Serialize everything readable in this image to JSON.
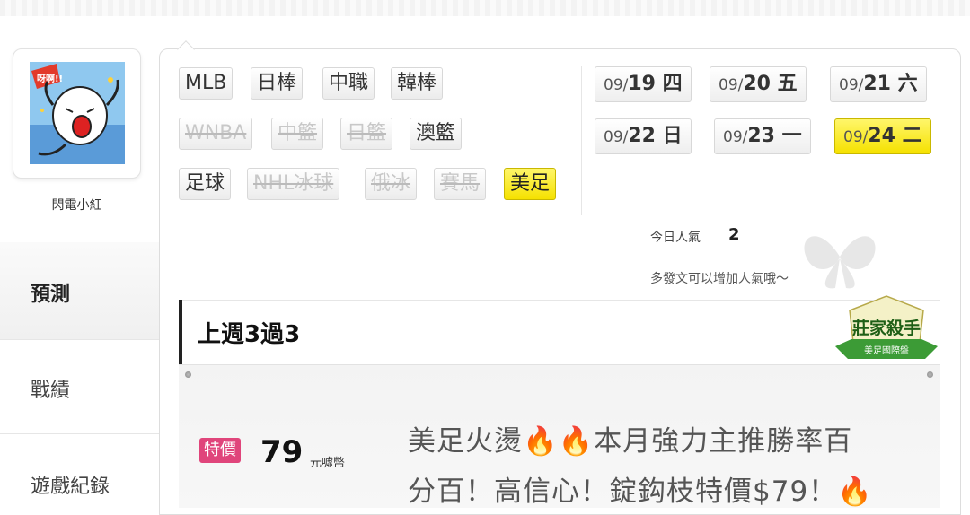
{
  "profile": {
    "username": "閃電小紅"
  },
  "nav": {
    "predict": "預測",
    "record": "戰績",
    "games": "遊戲紀錄"
  },
  "sport_tags": [
    {
      "label": "MLB",
      "state": "normal"
    },
    {
      "label": "日棒",
      "state": "normal"
    },
    {
      "label": "中職",
      "state": "normal"
    },
    {
      "label": "韓棒",
      "state": "normal"
    },
    {
      "label": "WNBA",
      "state": "disabled"
    },
    {
      "label": "中籃",
      "state": "disabled"
    },
    {
      "label": "日籃",
      "state": "disabled"
    },
    {
      "label": "澳籃",
      "state": "normal"
    },
    {
      "label": "足球",
      "state": "normal"
    },
    {
      "label": "NHL冰球",
      "state": "disabled"
    },
    {
      "label": "俄冰",
      "state": "disabled"
    },
    {
      "label": "賽馬",
      "state": "disabled"
    },
    {
      "label": "美足",
      "state": "active"
    }
  ],
  "dates": [
    {
      "month": "09/",
      "day": "19 四"
    },
    {
      "month": "09/",
      "day": "20 五"
    },
    {
      "month": "09/",
      "day": "21 六"
    },
    {
      "month": "09/",
      "day": "22 日"
    },
    {
      "month": "09/",
      "day": "23 一"
    },
    {
      "month": "09/",
      "day": "24 二",
      "active": true
    }
  ],
  "popularity": {
    "label": "今日人氣",
    "value": "2",
    "hint": "多發文可以增加人氣哦～"
  },
  "week_record": "上週3過3",
  "badge": {
    "title": "莊家殺手",
    "subtitle": "美足國際盤"
  },
  "article": {
    "special_label": "特價",
    "price": "79",
    "currency": "元噓幣",
    "title_line1_a": "美足火燙",
    "title_line1_b": "本月強力主推勝率百",
    "title_line2": "分百！高信心！錠鈎枝特價$79！",
    "fire": "🔥"
  },
  "colors": {
    "active_yellow": "#f5e100",
    "special_pink": "#e0457b",
    "fire": "#f25c05"
  }
}
